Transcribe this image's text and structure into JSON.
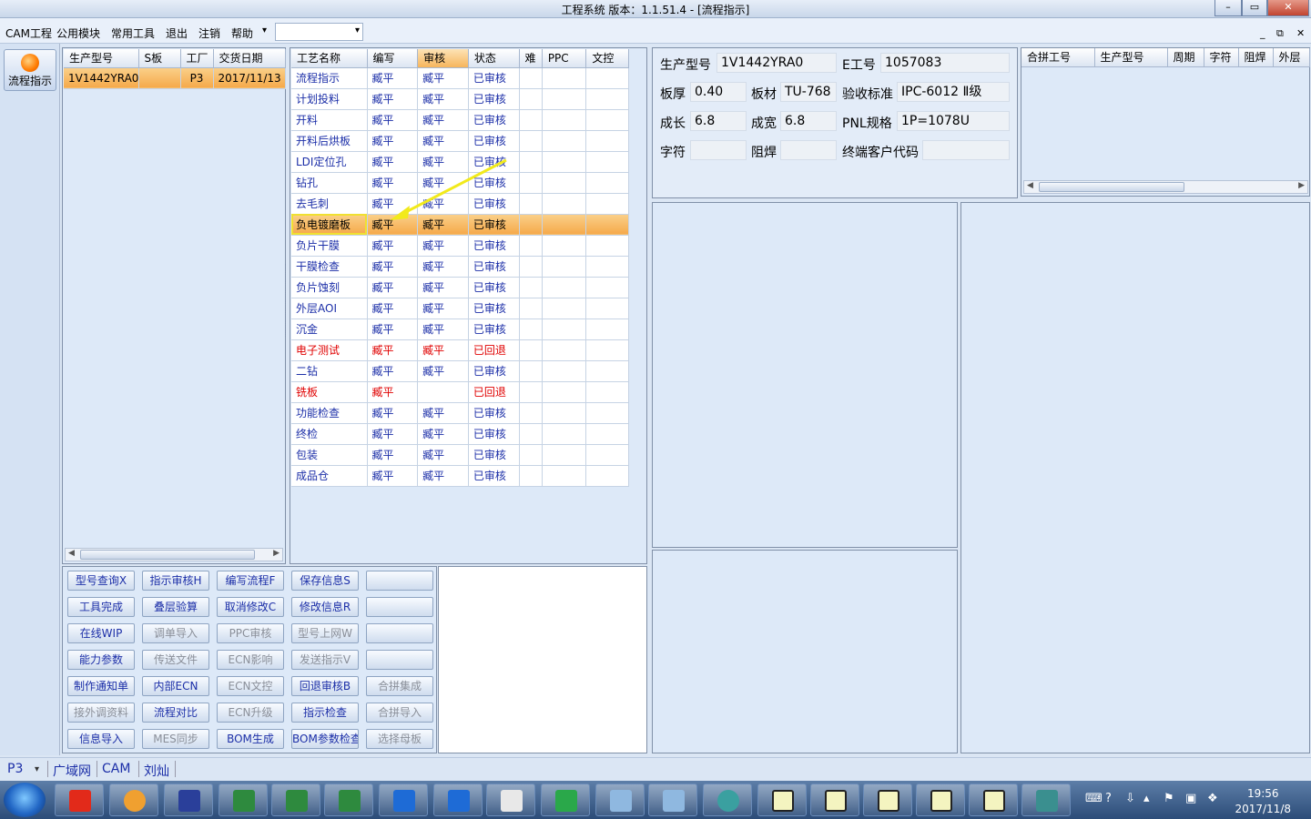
{
  "window": {
    "title": "工程系统    版本：1.1.51.4 - [流程指示]",
    "min": "–",
    "max": "▭",
    "close": "✕"
  },
  "menu": [
    "CAM工程",
    "公用模块",
    "常用工具",
    "退出",
    "注销",
    "帮助",
    "▾"
  ],
  "mdi": {
    "min": "_",
    "restore": "⧉",
    "close": "✕"
  },
  "sidebar": {
    "flow_label": "流程指示"
  },
  "orders": {
    "columns": [
      "生产型号",
      "S板",
      "工厂",
      "交货日期"
    ],
    "rows": [
      [
        "1V1442YRA0",
        "",
        "P3",
        "2017/11/13"
      ]
    ]
  },
  "process": {
    "columns": [
      "工艺名称",
      "编写",
      "审核",
      "状态",
      "难",
      "PPC",
      "文控"
    ],
    "rows": [
      {
        "name": "流程指示",
        "writer": "臧平",
        "reviewer": "臧平",
        "status": "已审核",
        "color": "blue"
      },
      {
        "name": "计划投料",
        "writer": "臧平",
        "reviewer": "臧平",
        "status": "已审核",
        "color": "blue"
      },
      {
        "name": "开料",
        "writer": "臧平",
        "reviewer": "臧平",
        "status": "已审核",
        "color": "blue"
      },
      {
        "name": "开料后烘板",
        "writer": "臧平",
        "reviewer": "臧平",
        "status": "已审核",
        "color": "blue"
      },
      {
        "name": "LDI定位孔",
        "writer": "臧平",
        "reviewer": "臧平",
        "status": "已审核",
        "color": "blue"
      },
      {
        "name": "钻孔",
        "writer": "臧平",
        "reviewer": "臧平",
        "status": "已审核",
        "color": "blue"
      },
      {
        "name": "去毛刺",
        "writer": "臧平",
        "reviewer": "臧平",
        "status": "已审核",
        "color": "blue"
      },
      {
        "name": "负电镀磨板",
        "writer": "臧平",
        "reviewer": "臧平",
        "status": "已审核",
        "color": "hl"
      },
      {
        "name": "负片干膜",
        "writer": "臧平",
        "reviewer": "臧平",
        "status": "已审核",
        "color": "blue"
      },
      {
        "name": "干膜检查",
        "writer": "臧平",
        "reviewer": "臧平",
        "status": "已审核",
        "color": "blue"
      },
      {
        "name": "负片蚀刻",
        "writer": "臧平",
        "reviewer": "臧平",
        "status": "已审核",
        "color": "blue"
      },
      {
        "name": "外层AOI",
        "writer": "臧平",
        "reviewer": "臧平",
        "status": "已审核",
        "color": "blue"
      },
      {
        "name": "沉金",
        "writer": "臧平",
        "reviewer": "臧平",
        "status": "已审核",
        "color": "blue"
      },
      {
        "name": "电子测试",
        "writer": "臧平",
        "reviewer": "臧平",
        "status": "已回退",
        "color": "red"
      },
      {
        "name": "二钻",
        "writer": "臧平",
        "reviewer": "臧平",
        "status": "已审核",
        "color": "blue"
      },
      {
        "name": "铣板",
        "writer": "臧平",
        "reviewer": "",
        "status": "已回退",
        "color": "red"
      },
      {
        "name": "功能检查",
        "writer": "臧平",
        "reviewer": "臧平",
        "status": "已审核",
        "color": "blue"
      },
      {
        "name": "终检",
        "writer": "臧平",
        "reviewer": "臧平",
        "status": "已审核",
        "color": "blue"
      },
      {
        "name": "包装",
        "writer": "臧平",
        "reviewer": "臧平",
        "status": "已审核",
        "color": "blue"
      },
      {
        "name": "成品仓",
        "writer": "臧平",
        "reviewer": "臧平",
        "status": "已审核",
        "color": "blue"
      }
    ]
  },
  "buttons": [
    [
      "型号查询X",
      "指示审核H",
      "编写流程F",
      "保存信息S",
      ""
    ],
    [
      "工具完成",
      "叠层验算",
      "取消修改C",
      "修改信息R",
      ""
    ],
    [
      "在线WIP",
      "调单导入",
      "PPC审核",
      "型号上网W",
      ""
    ],
    [
      "能力参数",
      "传送文件",
      "ECN影响",
      "发送指示V",
      ""
    ],
    [
      "制作通知单",
      "内部ECN",
      "ECN文控",
      "回退审核B",
      "合拼集成"
    ],
    [
      "接外调资料",
      "流程对比",
      "ECN升级",
      "指示检查",
      "合拼导入"
    ],
    [
      "信息导入",
      "MES同步",
      "BOM生成",
      "BOM参数检查",
      "选择母板"
    ]
  ],
  "buttons_disabled": [
    [
      false,
      false,
      false,
      false,
      false
    ],
    [
      false,
      false,
      false,
      false,
      false
    ],
    [
      false,
      true,
      true,
      true,
      false
    ],
    [
      false,
      true,
      true,
      true,
      false
    ],
    [
      false,
      false,
      true,
      false,
      true
    ],
    [
      true,
      false,
      true,
      false,
      true
    ],
    [
      false,
      true,
      false,
      false,
      true
    ]
  ],
  "info": {
    "model_label": "生产型号",
    "model": "1V1442YRA0",
    "e_label": "E工号",
    "e": "1057083",
    "thick_label": "板厚",
    "thick": "0.40",
    "mat_label": "板材",
    "mat": "TU-768",
    "std_label": "验收标准",
    "std": "IPC-6012 Ⅱ级",
    "len_label": "成长",
    "len": "6.8",
    "wid_label": "成宽",
    "wid": "6.8",
    "pnl_label": "PNL规格",
    "pnl": "1P=1078U",
    "char_label": "字符",
    "char": "",
    "mask_label": "阻焊",
    "mask": "",
    "cust_label": "终端客户代码",
    "cust": ""
  },
  "merge": {
    "columns": [
      "合拼工号",
      "生产型号",
      "周期",
      "字符",
      "阻焊",
      "外层"
    ]
  },
  "status": {
    "plant": "P3",
    "net": "广域网",
    "dept": "CAM",
    "user": "刘灿"
  },
  "clock": {
    "time": "19:56",
    "date": "2017/11/8"
  }
}
